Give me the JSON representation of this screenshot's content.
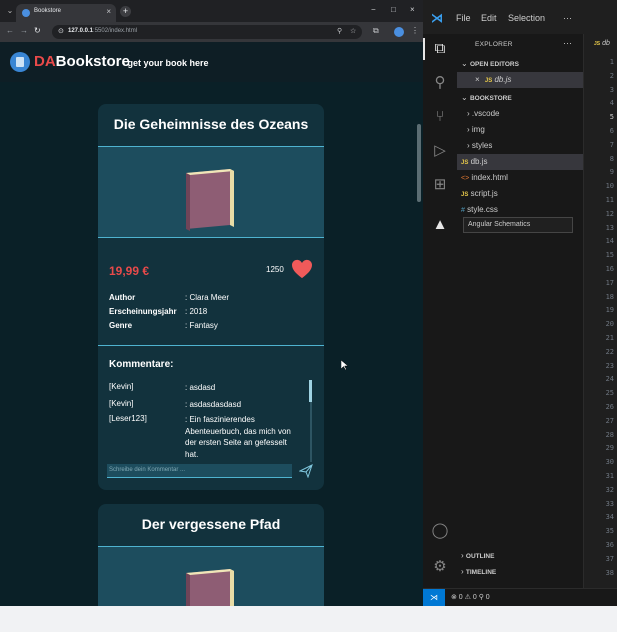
{
  "browser": {
    "tab_title": "Bookstore",
    "tab_close": "×",
    "new_tab": "+",
    "url_host": "127.0.0.1",
    "url_rest": ":5502/index.html"
  },
  "site": {
    "logo_da": "DA",
    "logo_rest": "Bookstore",
    "tagline": "- get your book here"
  },
  "books": [
    {
      "title": "Die Geheimnisse des Ozeans",
      "price": "19,99 €",
      "likes": "1250",
      "author_label": "Author",
      "author": ": Clara Meer",
      "year_label": "Erscheinungsjahr",
      "year": ": 2018",
      "genre_label": "Genre",
      "genre": ": Fantasy",
      "comments_heading": "Kommentare:",
      "comments": [
        {
          "user": "[Kevin]",
          "text": ": asdasd"
        },
        {
          "user": "[Kevin]",
          "text": ": asdasdasdasd"
        },
        {
          "user": "[Leser123]",
          "text": ": Ein faszinierendes Abenteuerbuch, das mich von der ersten Seite an gefesselt hat."
        }
      ],
      "comment_placeholder": "Schreibe dein Kommentar ..."
    },
    {
      "title": "Der vergessene Pfad"
    }
  ],
  "vscode": {
    "menu": [
      "File",
      "Edit",
      "Selection",
      "···"
    ],
    "explorer_title": "EXPLORER",
    "explorer_more": "···",
    "open_editors": "OPEN EDITORS",
    "open_file_close": "×",
    "open_file_badge": "JS",
    "open_file": "db.js",
    "folder": "BOOKSTORE",
    "tree": [
      {
        "name": ".vscode",
        "kind": "folder"
      },
      {
        "name": "img",
        "kind": "folder"
      },
      {
        "name": "styles",
        "kind": "folder"
      },
      {
        "name": "db.js",
        "kind": "js",
        "badge": "JS"
      },
      {
        "name": "index.html",
        "kind": "html",
        "badge": "<>"
      },
      {
        "name": "script.js",
        "kind": "js",
        "badge": "JS"
      },
      {
        "name": "style.css",
        "kind": "css",
        "badge": "#"
      }
    ],
    "tooltip": "Angular Schematics",
    "outline": "OUTLINE",
    "timeline": "TIMELINE",
    "editor_tab_badge": "JS",
    "editor_tab": "db",
    "line_numbers": [
      "1",
      "2",
      "3",
      "4",
      "5",
      "6",
      "7",
      "8",
      "9",
      "10",
      "11",
      "12",
      "13",
      "14",
      "15",
      "16",
      "17",
      "18",
      "19",
      "20",
      "21",
      "22",
      "23",
      "24",
      "25",
      "26",
      "27",
      "28",
      "29",
      "30",
      "31",
      "32",
      "33",
      "34",
      "35",
      "36",
      "37",
      "38"
    ],
    "current_line": "5",
    "status": "⊗ 0 ⚠ 0   ⚲ 0"
  },
  "colors": {
    "accent_red": "#e84a4a",
    "card_bg": "#12323d",
    "card_border": "#4fb3d0",
    "page_bg": "#0a2027",
    "vscode_blue": "#0078d4"
  }
}
